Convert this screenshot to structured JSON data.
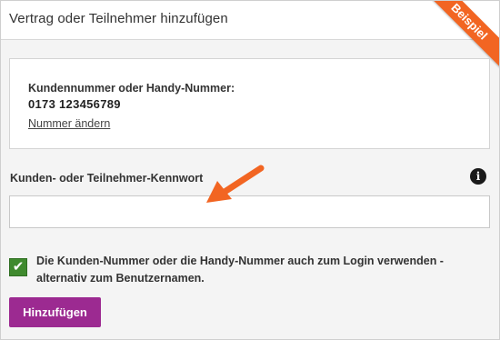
{
  "header": {
    "title": "Vertrag oder Teilnehmer hinzufügen",
    "ribbon_label": "Beispiel",
    "ribbon_color": "#f26522"
  },
  "card": {
    "label": "Kundennummer oder Handy-Nummer:",
    "value": "0173 123456789",
    "change_link": "Nummer ändern"
  },
  "password": {
    "label": "Kunden- oder Teilnehmer-Kennwort",
    "value": "",
    "info_icon": "info-icon"
  },
  "annotation": {
    "arrow_color": "#f26522"
  },
  "login_option": {
    "checked": true,
    "label": "Die Kunden-Nummer oder die Handy-Nummer auch zum Login verwenden - alternativ zum Benutzernamen.",
    "check_color": "#3f8a2e"
  },
  "actions": {
    "submit_label": "Hinzufügen",
    "submit_color": "#9c2a91"
  }
}
